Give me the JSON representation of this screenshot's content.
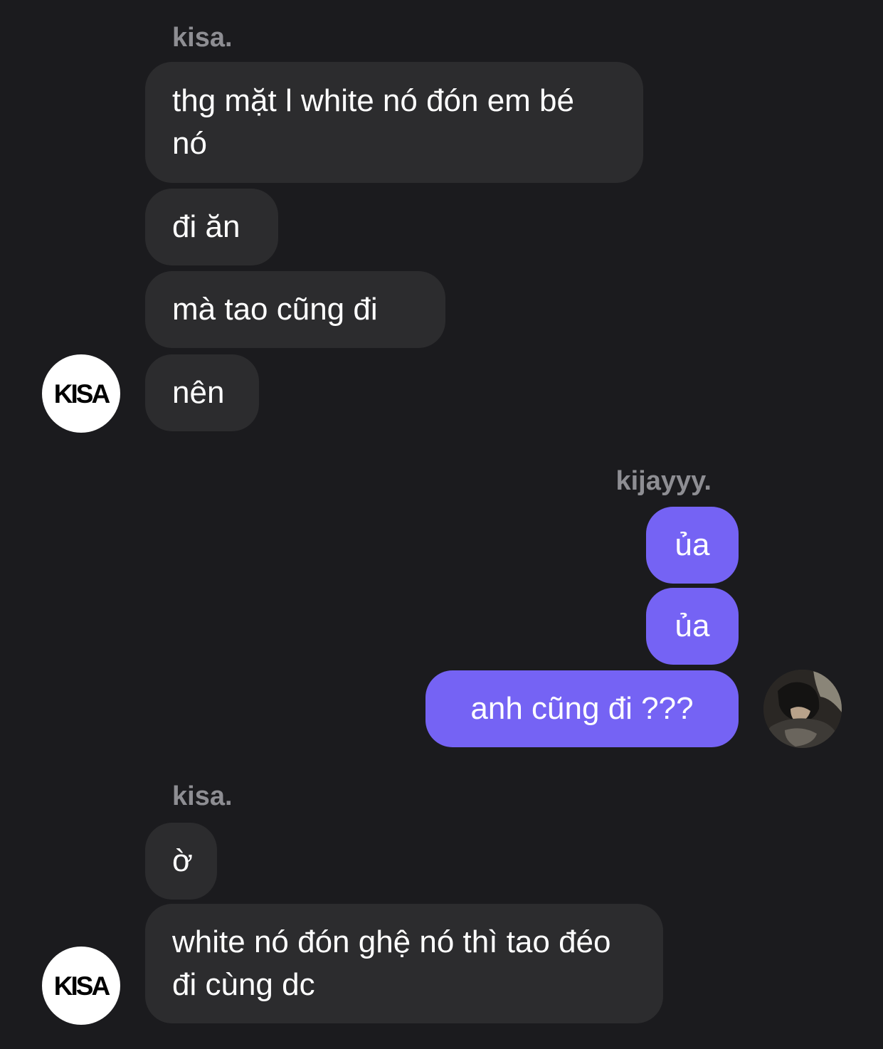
{
  "colors": {
    "background": "#1b1b1e",
    "incoming_bubble": "#2c2c2e",
    "outgoing_bubble": "#7563f4",
    "sender_name": "#8e8e93",
    "text": "#ffffff"
  },
  "group1": {
    "sender": "kisa.",
    "messages": [
      "thg mặt l white nó đón em bé nó",
      "đi ăn",
      "mà tao cũng đi",
      "nên"
    ],
    "avatar_text": "KISA"
  },
  "group2": {
    "sender": "kijayyy.",
    "messages": [
      "ủa",
      "ủa",
      "anh cũng đi ???"
    ],
    "avatar_icon": "profile-photo"
  },
  "group3": {
    "sender": "kisa.",
    "messages": [
      "ờ",
      "white nó đón ghệ nó thì tao đéo đi cùng dc"
    ],
    "avatar_text": "KISA"
  }
}
